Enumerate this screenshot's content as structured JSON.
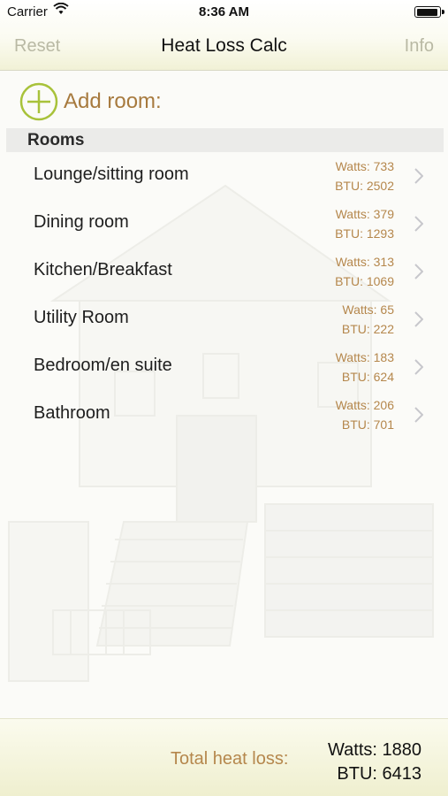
{
  "status_bar": {
    "carrier": "Carrier",
    "time": "8:36 AM",
    "battery_level": 0.85
  },
  "nav": {
    "left_label": "Reset",
    "title": "Heat Loss Calc",
    "right_label": "Info"
  },
  "add_room": {
    "label": "Add room:",
    "icon": "plus-circle-icon"
  },
  "rooms_section": {
    "header": "Rooms",
    "items": [
      {
        "name": "Lounge/sitting room",
        "watts": "Watts: 733",
        "btu": "BTU: 2502"
      },
      {
        "name": "Dining room",
        "watts": "Watts: 379",
        "btu": "BTU: 1293"
      },
      {
        "name": "Kitchen/Breakfast",
        "watts": "Watts: 313",
        "btu": "BTU: 1069"
      },
      {
        "name": "Utility Room",
        "watts": "Watts: 65",
        "btu": "BTU: 222"
      },
      {
        "name": "Bedroom/en suite",
        "watts": "Watts: 183",
        "btu": "BTU: 624"
      },
      {
        "name": "Bathroom",
        "watts": "Watts: 206",
        "btu": "BTU: 701"
      }
    ]
  },
  "footer": {
    "total_label": "Total heat loss:",
    "total_watts": "Watts: 1880",
    "total_btu": "BTU: 6413"
  },
  "colors": {
    "accent_gold": "#b5874c",
    "accent_green": "#a8c23a",
    "nav_inactive": "#b9b9a4"
  }
}
